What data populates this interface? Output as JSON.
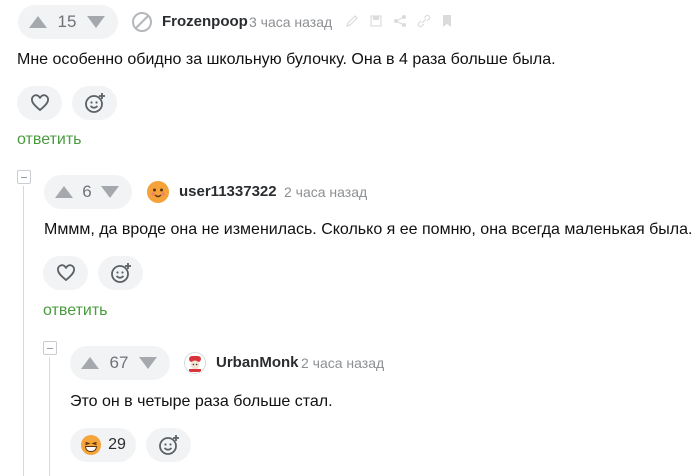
{
  "comments": [
    {
      "votes": "15",
      "username": "Frozenpoop",
      "time": "3 часа назад",
      "text": "Мне особенно обидно за школьную булочку. Она в 4 раза больше была.",
      "reply_label": "ответить"
    },
    {
      "votes": "6",
      "username": "user11337322",
      "time": "2 часа назад",
      "text": "Мммм, да вроде она не изменилась. Сколько я ее помню, она всегда маленькая была.",
      "reply_label": "ответить"
    },
    {
      "votes": "67",
      "username": "UrbanMonk",
      "time": "2 часа назад",
      "text": "Это он в четыре раза больше стал.",
      "reaction_count": "29"
    }
  ],
  "colors": {
    "reply_green": "#4a9a3f",
    "pill_bg": "#f2f3f5",
    "muted": "#8c8f93"
  },
  "icons": {
    "upvote": "triangle-up-icon",
    "downvote": "triangle-down-icon",
    "like": "heart-icon",
    "add_reaction": "add-emoji-icon",
    "banned_avatar": "circle-slash-icon",
    "laughing_reaction": "laughing-emoji-icon"
  }
}
